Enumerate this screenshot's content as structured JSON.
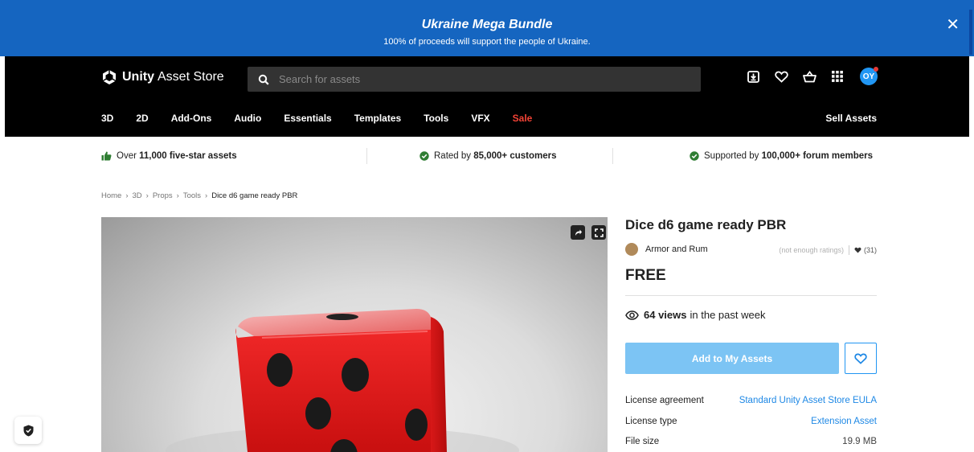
{
  "banner": {
    "title": "Ukraine Mega Bundle",
    "subtitle": "100% of proceeds will support the people of Ukraine.",
    "close_glyph": "✕"
  },
  "header": {
    "logo_bold": "Unity",
    "logo_rest": "Asset Store",
    "search_placeholder": "Search for assets",
    "avatar_initials": "OY",
    "icons": [
      "download-icon",
      "heart-icon",
      "cart-icon",
      "apps-grid-icon"
    ]
  },
  "nav": {
    "items": [
      "3D",
      "2D",
      "Add-Ons",
      "Audio",
      "Essentials",
      "Templates",
      "Tools",
      "VFX",
      "Sale"
    ],
    "sell": "Sell Assets"
  },
  "trust": {
    "item1_prefix": "Over ",
    "item1_bold": "11,000 five-star assets",
    "item2_prefix": "Rated by ",
    "item2_bold": "85,000+ customers",
    "item3_prefix": "Supported by ",
    "item3_bold": "100,000+ forum members"
  },
  "breadcrumb": {
    "items": [
      "Home",
      "3D",
      "Props",
      "Tools"
    ],
    "current": "Dice d6 game ready PBR",
    "separator": "›"
  },
  "product": {
    "title": "Dice d6 game ready PBR",
    "publisher": "Armor and Rum",
    "rating_text": "(not enough ratings)",
    "favorites": "(31)",
    "price": "FREE",
    "views_bold": "64 views",
    "views_rest": "in the past week",
    "add_button": "Add to My Assets",
    "details": [
      {
        "key": "License agreement",
        "value": "Standard Unity Asset Store EULA"
      },
      {
        "key": "License type",
        "value": "Extension Asset"
      },
      {
        "key": "File size",
        "value": "19.9 MB"
      }
    ]
  },
  "colors": {
    "banner": "#1565c0",
    "header": "#000000",
    "sale": "#f44336",
    "add_button": "#7cc4f4",
    "link": "#1e88e5",
    "dice": "#e21d1d"
  }
}
